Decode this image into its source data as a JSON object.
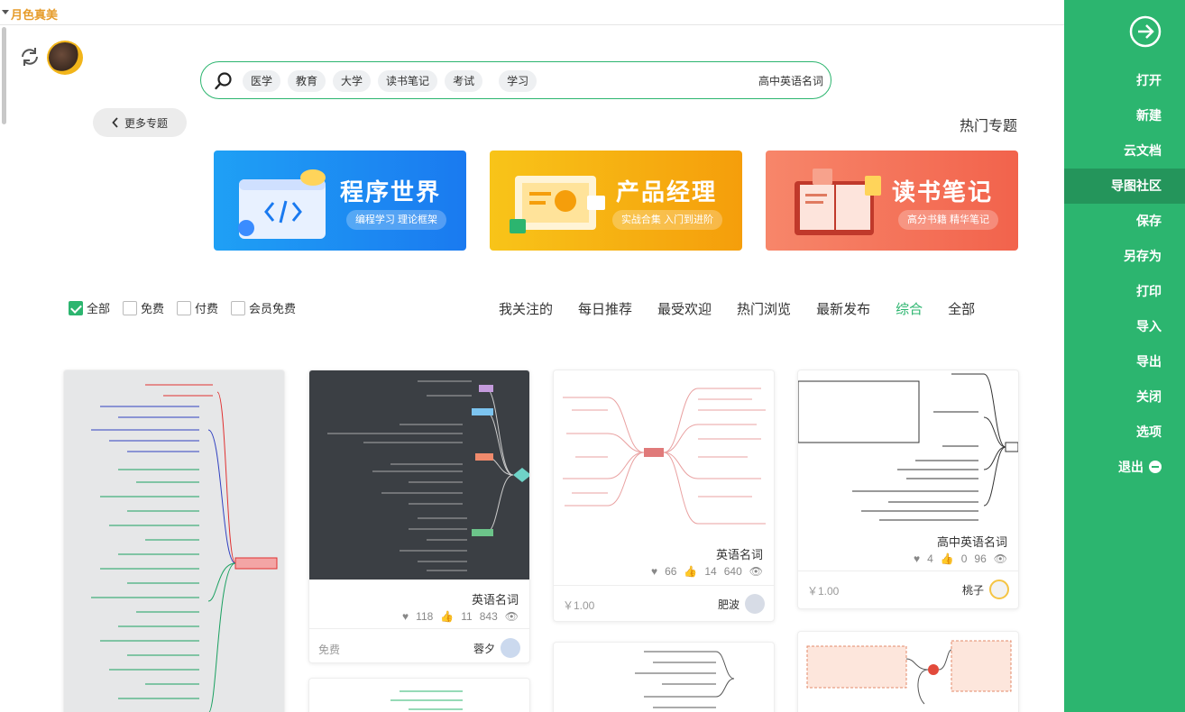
{
  "theme": {
    "label": "月色真美"
  },
  "search": {
    "tags": [
      "医学",
      "教育",
      "大学",
      "读书笔记",
      "考试",
      "学习"
    ],
    "query": "高中英语名词"
  },
  "topics": {
    "more_label": "更多专题",
    "title": "热门专题",
    "banners": [
      {
        "title": "程序世界",
        "subtitle": "编程学习 理论框架"
      },
      {
        "title": "产品经理",
        "subtitle": "实战合集 入门到进阶"
      },
      {
        "title": "读书笔记",
        "subtitle": "高分书籍 精华笔记"
      }
    ]
  },
  "filters": [
    {
      "label": "全部",
      "checked": true
    },
    {
      "label": "免费",
      "checked": false
    },
    {
      "label": "付费",
      "checked": false
    },
    {
      "label": "会员免费",
      "checked": false
    }
  ],
  "sorts": [
    "我关注的",
    "每日推荐",
    "最受欢迎",
    "热门浏览",
    "最新发布",
    "综合",
    "全部"
  ],
  "cards": [
    {
      "title": "",
      "views": "",
      "likes": "",
      "favs": "",
      "author": "",
      "price": ""
    },
    {
      "title": "英语名词",
      "views": "843",
      "likes": "11",
      "favs": "118",
      "author": "蓉夕",
      "price": "免费"
    },
    {
      "title": "英语名词",
      "views": "640",
      "likes": "14",
      "favs": "66",
      "author": "肥波",
      "price": "￥1.00"
    },
    {
      "title": "高中英语名词",
      "views": "96",
      "likes": "0",
      "favs": "4",
      "author": "桃子",
      "price": "￥1.00"
    }
  ],
  "sidebar": {
    "items": [
      "打开",
      "新建",
      "云文档",
      "导图社区",
      "保存",
      "另存为",
      "打印",
      "导入",
      "导出",
      "关闭",
      "选项",
      "退出"
    ],
    "active": "导图社区"
  },
  "colors": {
    "accent": "#2cb56f",
    "accent_dark": "#24955b",
    "theme_label": "#e69c2b"
  }
}
